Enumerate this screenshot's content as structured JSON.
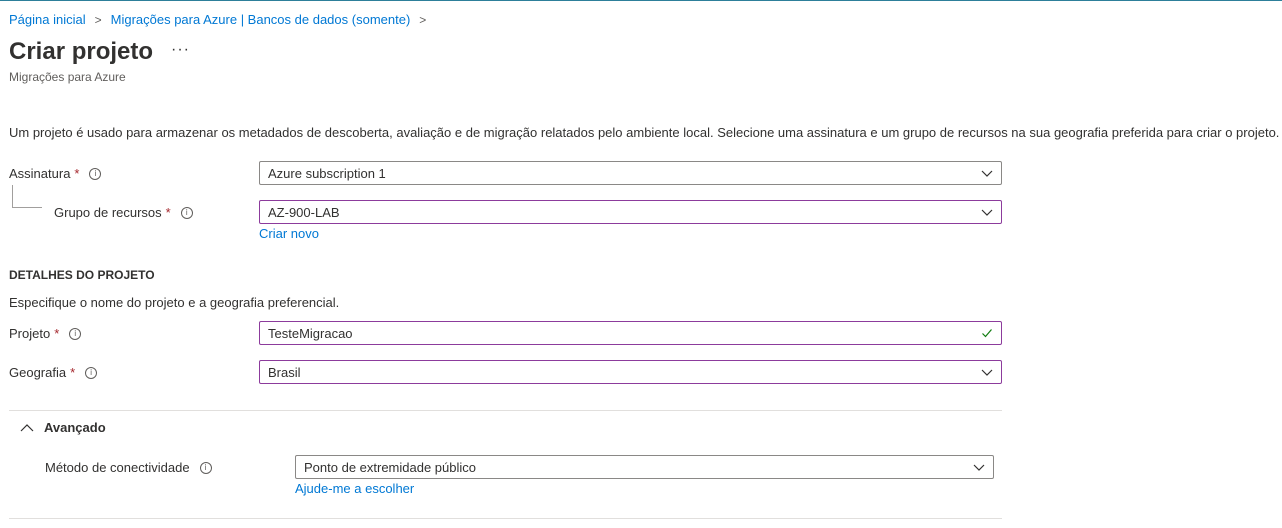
{
  "breadcrumb": {
    "items": [
      "Página inicial",
      "Migrações para Azure | Bancos de dados (somente)"
    ]
  },
  "header": {
    "title": "Criar projeto",
    "more": "···",
    "subtitle": "Migrações para Azure"
  },
  "description": "Um projeto é usado para armazenar os metadados de descoberta, avaliação e de migração relatados pelo ambiente local. Selecione uma assinatura e um grupo de recursos na sua geografia preferida para criar o projeto.",
  "subscription": {
    "label": "Assinatura",
    "required": "*",
    "value": "Azure subscription 1"
  },
  "resource_group": {
    "label": "Grupo de recursos",
    "required": "*",
    "value": "AZ-900-LAB",
    "create_new": "Criar novo"
  },
  "project_details": {
    "heading": "DETALHES DO PROJETO",
    "description": "Especifique o nome do projeto e a geografia preferencial."
  },
  "project": {
    "label": "Projeto",
    "required": "*",
    "value": "TesteMigracao"
  },
  "geography": {
    "label": "Geografia",
    "required": "*",
    "value": "Brasil"
  },
  "advanced": {
    "heading": "Avançado",
    "connectivity": {
      "label": "Método de conectividade",
      "value": "Ponto de extremidade público",
      "help": "Ajude-me a escolher"
    }
  },
  "colors": {
    "accent": "#0078d4",
    "focus_border": "#8c3b9c",
    "required": "#a4262c",
    "valid": "#107c10"
  },
  "icons": {
    "info": "info-icon",
    "chevron": "chevron-down-icon",
    "valid": "checkmark-icon",
    "collapse": "chevron-up-icon"
  }
}
